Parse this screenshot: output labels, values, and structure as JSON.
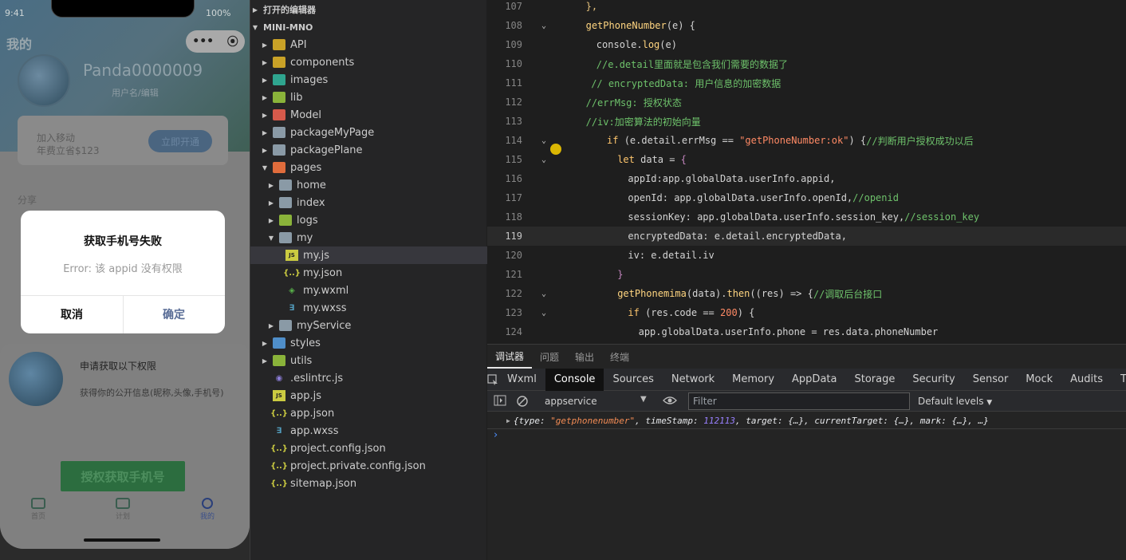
{
  "phone": {
    "status_time": "9:41",
    "status_right": "100%",
    "page_title": "我的",
    "capsule_more": "•••",
    "capsule_close": "⦿",
    "user_name": "Panda0000009",
    "user_sub": "用户名/编辑",
    "vip_line1": "加入移动",
    "vip_line2": "年费立省$123",
    "vip_button": "立即开通",
    "share_label": "分享",
    "dialog": {
      "title": "获取手机号失败",
      "message": "Error: 该 appid 没有权限",
      "cancel": "取消",
      "confirm": "确定"
    },
    "sheet": {
      "title": "申请获取以下权限",
      "desc": "获得你的公开信息(昵称,头像,手机号)",
      "button": "授权获取手机号"
    },
    "tabs": [
      {
        "label": "首页"
      },
      {
        "label": "计划"
      },
      {
        "label": "我的"
      }
    ]
  },
  "explorer": {
    "open_editors": "打开的编辑器",
    "project": "MINI-MNO",
    "items": [
      {
        "label": "API",
        "depth": 1,
        "kind": "folder",
        "color": "#c9a227",
        "expanded": false
      },
      {
        "label": "components",
        "depth": 1,
        "kind": "folder",
        "color": "#c9a227",
        "expanded": false
      },
      {
        "label": "images",
        "depth": 1,
        "kind": "folder",
        "color": "#2fa58f",
        "expanded": false
      },
      {
        "label": "lib",
        "depth": 1,
        "kind": "folder",
        "color": "#8ab33a",
        "expanded": false
      },
      {
        "label": "Model",
        "depth": 1,
        "kind": "folder",
        "color": "#d65a4b",
        "expanded": false
      },
      {
        "label": "packageMyPage",
        "depth": 1,
        "kind": "folder",
        "color": "#8a9aa6",
        "expanded": false
      },
      {
        "label": "packagePlane",
        "depth": 1,
        "kind": "folder",
        "color": "#8a9aa6",
        "expanded": false
      },
      {
        "label": "pages",
        "depth": 1,
        "kind": "folder",
        "color": "#e06c3c",
        "expanded": true
      },
      {
        "label": "home",
        "depth": 2,
        "kind": "folder",
        "color": "#8a9aa6",
        "expanded": false
      },
      {
        "label": "index",
        "depth": 2,
        "kind": "folder",
        "color": "#8a9aa6",
        "expanded": false
      },
      {
        "label": "logs",
        "depth": 2,
        "kind": "folder",
        "color": "#8ab33a",
        "expanded": false
      },
      {
        "label": "my",
        "depth": 2,
        "kind": "folder",
        "color": "#8a9aa6",
        "expanded": true
      },
      {
        "label": "my.js",
        "depth": 3,
        "kind": "js"
      },
      {
        "label": "my.json",
        "depth": 3,
        "kind": "json"
      },
      {
        "label": "my.wxml",
        "depth": 3,
        "kind": "wxml"
      },
      {
        "label": "my.wxss",
        "depth": 3,
        "kind": "wxss"
      },
      {
        "label": "myService",
        "depth": 2,
        "kind": "folder",
        "color": "#8a9aa6",
        "expanded": false
      },
      {
        "label": "styles",
        "depth": 1,
        "kind": "folder",
        "color": "#4f8ec9",
        "expanded": false
      },
      {
        "label": "utils",
        "depth": 1,
        "kind": "folder",
        "color": "#8ab33a",
        "expanded": false
      },
      {
        "label": ".eslintrc.js",
        "depth": 1,
        "kind": "eslint"
      },
      {
        "label": "app.js",
        "depth": 1,
        "kind": "js"
      },
      {
        "label": "app.json",
        "depth": 1,
        "kind": "json"
      },
      {
        "label": "app.wxss",
        "depth": 1,
        "kind": "wxss"
      },
      {
        "label": "project.config.json",
        "depth": 1,
        "kind": "json"
      },
      {
        "label": "project.private.config.json",
        "depth": 1,
        "kind": "json"
      },
      {
        "label": "sitemap.json",
        "depth": 1,
        "kind": "json"
      }
    ],
    "selected": "my.js"
  },
  "editor": {
    "current_line": 119,
    "lines": [
      {
        "n": "107",
        "fold": "",
        "indent": 6,
        "parts": [
          [
            "p",
            "},"
          ]
        ]
      },
      {
        "n": "108",
        "fold": "v",
        "indent": 6,
        "parts": [
          [
            "f",
            "getPhoneNumber"
          ],
          [
            "code",
            "(e) {"
          ]
        ]
      },
      {
        "n": "109",
        "fold": "",
        "indent": 8,
        "parts": [
          [
            "code",
            "console."
          ],
          [
            "f",
            "log"
          ],
          [
            "code",
            "(e)"
          ]
        ]
      },
      {
        "n": "110",
        "fold": "",
        "indent": 8,
        "parts": [
          [
            "c",
            "//e.detail里面就是包含我们需要的数据了"
          ]
        ]
      },
      {
        "n": "111",
        "fold": "",
        "indent": 7,
        "parts": [
          [
            "c",
            "// encryptedData: 用户信息的加密数据"
          ]
        ]
      },
      {
        "n": "112",
        "fold": "",
        "indent": 6,
        "parts": [
          [
            "c",
            "//errMsg: 授权状态"
          ]
        ]
      },
      {
        "n": "113",
        "fold": "",
        "indent": 6,
        "parts": [
          [
            "c",
            "//iv:加密算法的初始向量"
          ]
        ]
      },
      {
        "n": "114",
        "fold": "v",
        "indent": 10,
        "parts": [
          [
            "k",
            "if "
          ],
          [
            "code",
            "(e.detail.errMsg == "
          ],
          [
            "s",
            "\"getPhoneNumber:ok\""
          ],
          [
            "code",
            ") {"
          ],
          [
            "c",
            "//判断用户授权成功以后"
          ]
        ]
      },
      {
        "n": "115",
        "fold": "v",
        "indent": 12,
        "parts": [
          [
            "k",
            "let "
          ],
          [
            "code",
            "data = "
          ],
          [
            "br",
            "{"
          ]
        ]
      },
      {
        "n": "116",
        "fold": "",
        "indent": 14,
        "parts": [
          [
            "code",
            "appId:app.globalData.userInfo.appid,"
          ]
        ]
      },
      {
        "n": "117",
        "fold": "",
        "indent": 14,
        "parts": [
          [
            "code",
            "openId: app.globalData.userInfo.openId,"
          ],
          [
            "c",
            "//openid"
          ]
        ]
      },
      {
        "n": "118",
        "fold": "",
        "indent": 14,
        "parts": [
          [
            "code",
            "sessionKey: app.globalData.userInfo.session_key,"
          ],
          [
            "c",
            "//session_key"
          ]
        ]
      },
      {
        "n": "119",
        "fold": "",
        "indent": 14,
        "parts": [
          [
            "code",
            "encryptedData: e.detail.encryptedData,"
          ]
        ]
      },
      {
        "n": "120",
        "fold": "",
        "indent": 14,
        "parts": [
          [
            "code",
            "iv: e.detail.iv"
          ]
        ]
      },
      {
        "n": "121",
        "fold": "",
        "indent": 12,
        "parts": [
          [
            "br",
            "}"
          ]
        ]
      },
      {
        "n": "122",
        "fold": "v",
        "indent": 12,
        "parts": [
          [
            "f",
            "getPhonemima"
          ],
          [
            "code",
            "(data)."
          ],
          [
            "f",
            "then"
          ],
          [
            "code",
            "((res) => {"
          ],
          [
            "c",
            "//调取后台接口"
          ]
        ]
      },
      {
        "n": "123",
        "fold": "v",
        "indent": 14,
        "parts": [
          [
            "k",
            "if "
          ],
          [
            "code",
            "(res.code == "
          ],
          [
            "s",
            "200"
          ],
          [
            "code",
            ") {"
          ]
        ]
      },
      {
        "n": "124",
        "fold": "",
        "indent": 16,
        "parts": [
          [
            "code",
            "app.globalData.userInfo.phone = res.data.phoneNumber"
          ]
        ]
      }
    ]
  },
  "devtools": {
    "tabs": [
      "调试器",
      "问题",
      "输出",
      "终端"
    ],
    "active_tab": "调试器",
    "panels": [
      "Wxml",
      "Console",
      "Sources",
      "Network",
      "Memory",
      "AppData",
      "Storage",
      "Security",
      "Sensor",
      "Mock",
      "Audits",
      "Trace"
    ],
    "active_panel": "Console",
    "context": "appservice",
    "filter_placeholder": "Filter",
    "levels": "Default levels",
    "console_entry": "{type: \"getphonenumber\", timeStamp: 112113, target: {…}, currentTarget: {…}, mark: {…}, …}",
    "prompt": "›"
  }
}
